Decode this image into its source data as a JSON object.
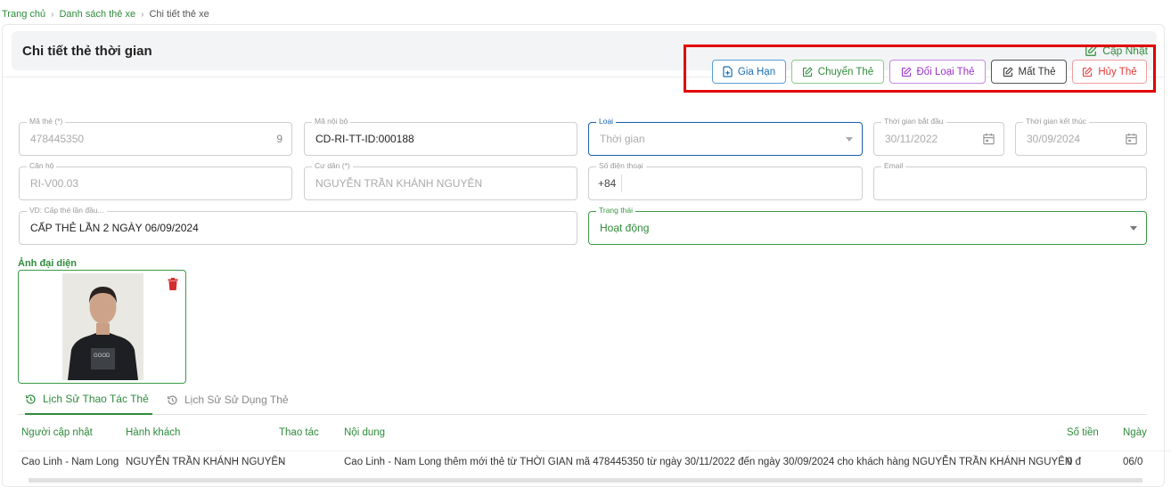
{
  "breadcrumb": {
    "home": "Trang chủ",
    "list": "Danh sách thẻ xe",
    "current": "Chi tiết thẻ xe"
  },
  "header": {
    "title": "Chi tiết thẻ thời gian",
    "update_label": "Cập Nhật"
  },
  "actions": {
    "extend": "Gia Hạn",
    "transfer": "Chuyển Thẻ",
    "change_type": "Đổi Loại Thẻ",
    "lost": "Mất Thẻ",
    "cancel": "Hủy Thẻ"
  },
  "form": {
    "card_code": {
      "label": "Mã thẻ (*)",
      "value": "478445350",
      "suffix": "9"
    },
    "internal_code": {
      "label": "Mã nội bộ",
      "value": "CD-RI-TT-ID:000188"
    },
    "type": {
      "label": "Loại",
      "value": "Thời gian"
    },
    "start_date": {
      "label": "Thời gian bắt đầu",
      "value": "30/11/2022"
    },
    "end_date": {
      "label": "Thời gian kết thúc",
      "value": "30/09/2024"
    },
    "apartment": {
      "label": "Căn hộ",
      "value": "RI-V00.03"
    },
    "resident": {
      "label": "Cư dân (*)",
      "value": "NGUYỄN TRẦN KHÁNH NGUYÊN"
    },
    "phone": {
      "label": "Số điện thoại",
      "prefix": "+84",
      "value": ""
    },
    "email": {
      "label": "Email",
      "value": ""
    },
    "note": {
      "label": "VD: Cấp thẻ lần đầu...",
      "value": "CẤP THẺ LẦN 2 NGÀY 06/09/2024"
    },
    "status": {
      "label": "Trạng thái",
      "value": "Hoạt động"
    }
  },
  "avatar": {
    "label": "Ảnh đại diện"
  },
  "tabs": [
    {
      "label": "Lịch Sử Thao Tác Thẻ"
    },
    {
      "label": "Lịch Sử Sử Dụng Thẻ"
    }
  ],
  "table": {
    "headers": [
      "Người cập nhật",
      "Hành khách",
      "Thao tác",
      "Nội dung",
      "Số tiền",
      "Ngày"
    ],
    "rows": [
      [
        "Cao Linh - Nam Long",
        "NGUYỄN TRẦN KHÁNH NGUYÊN",
        "-",
        "Cao Linh - Nam Long thêm mới thẻ từ THỜI GIAN mã 478445350 từ ngày 30/11/2022 đến ngày 30/09/2024 cho khách hàng NGUYỄN TRẦN KHÁNH NGUYÊN",
        "0 đ",
        "06/0"
      ]
    ]
  },
  "colors": {
    "primary_green": "#2e8b3a",
    "highlight_red": "#e00000"
  }
}
